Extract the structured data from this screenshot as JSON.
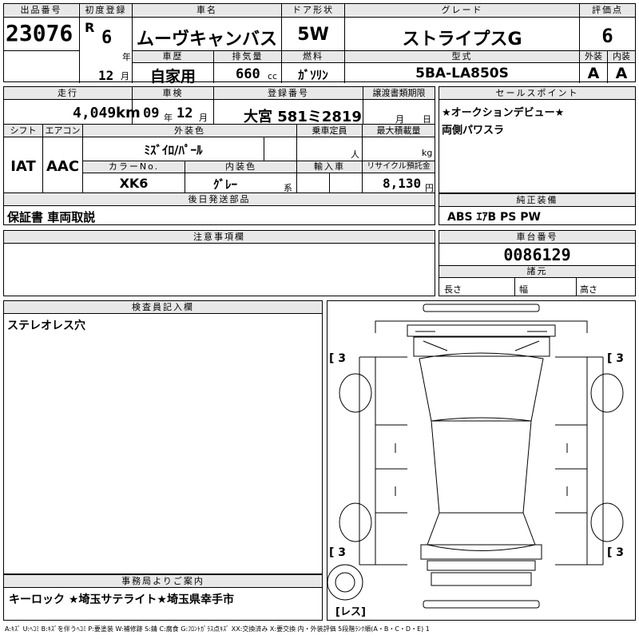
{
  "header": {
    "lot_label": "出品番号",
    "lot": "23076",
    "first_reg_label": "初度登録",
    "era": "R",
    "year": "6",
    "year_unit": "年",
    "month": "12",
    "month_unit": "月",
    "car_name_label": "車名",
    "car_name": "ムーヴキャンバス",
    "door_label": "ドア形状",
    "door": "5W",
    "grade_label": "グレード",
    "grade": "ストライプスG",
    "score_label": "評価点",
    "score": "6",
    "history_label": "車歴",
    "history": "自家用",
    "displacement_label": "排気量",
    "displacement": "660",
    "displacement_unit": "cc",
    "fuel_label": "燃料",
    "fuel": "ｶﾞｿﾘﾝ",
    "model_label": "型式",
    "model": "5BA-LA850S",
    "exterior_label": "外装",
    "exterior": "A",
    "interior_label": "内装",
    "interior": "A"
  },
  "row2": {
    "mileage_label": "走行",
    "mileage": "4,049",
    "mileage_unit": "km",
    "inspection_label": "車検",
    "insp_year": "09",
    "insp_year_unit": "年",
    "insp_month": "12",
    "insp_month_unit": "月",
    "plate_label": "登録番号",
    "plate": "大宮 581ミ2819",
    "transfer_label": "譲渡書類期限",
    "transfer_month_unit": "月",
    "transfer_day_unit": "日",
    "shift_label": "シフト",
    "shift": "IAT",
    "aircon_label": "エアコン",
    "aircon": "AAC",
    "ext_color_label": "外装色",
    "ext_color": "ﾐｽﾞｲﾛ/ﾊﾟｰﾙ",
    "capacity_label": "乗車定員",
    "capacity_unit": "人",
    "load_label": "最大積載量",
    "load_unit": "kg",
    "color_no_label": "カラーNo.",
    "color_no": "XK6",
    "int_color_label": "内装色",
    "int_color": "ｸﾞﾚｰ",
    "int_color_unit": "系",
    "import_label": "輸入車",
    "recycle_label": "リサイクル預託金",
    "recycle": "8,130",
    "recycle_unit": "円"
  },
  "sales_point": {
    "label": "セールスポイント",
    "line1": "★オークションデビュー★",
    "line2": "両側パワスラ"
  },
  "later_parts": {
    "label": "後日発送部品",
    "text": "保証書 車両取説"
  },
  "equipment": {
    "label": "純正装備",
    "text": "ABS ｴｱB PS PW"
  },
  "notes": {
    "label": "注意事項欄"
  },
  "chassis": {
    "label": "車台番号",
    "number": "0086129",
    "specs_label": "諸元",
    "length": "長さ",
    "width": "幅",
    "height": "高さ"
  },
  "inspector": {
    "label": "検査員記入欄",
    "text": "ステレオレス穴"
  },
  "office": {
    "label": "事務局よりご案内",
    "text": "キーロック ★埼玉サテライト★埼玉県幸手市"
  },
  "diagram": {
    "mark_tl": "3",
    "mark_tr": "3",
    "mark_bl": "3",
    "mark_br": "3",
    "mark_spare": "レス"
  },
  "legend": "A:ｷｽﾞ U:ﾍｺﾐ B:ｷｽﾞを伴うﾍｺﾐ P:要塗装 W:補修跡 S:錆 C:腐食 G:ﾌﾛﾝﾄｶﾞﾗｽ点ｷｽﾞ XX:交換済み X:要交換 内・外装評価 5段階ﾗﾝｸ順(A・B・C・D・E) 1"
}
